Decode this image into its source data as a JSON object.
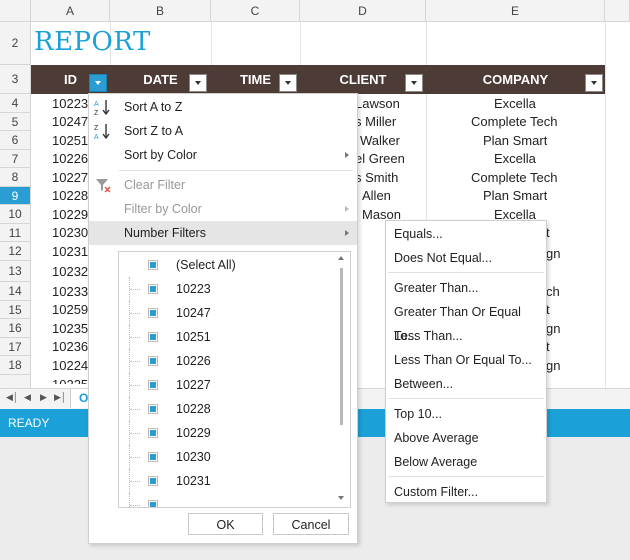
{
  "sheet": {
    "columns": [
      "A",
      "B",
      "C",
      "D",
      "E"
    ],
    "rows": [
      "2",
      "3",
      "4",
      "5",
      "6",
      "7",
      "8",
      "9",
      "10",
      "11",
      "12",
      "13",
      "14",
      "15",
      "16",
      "17",
      "18"
    ],
    "selected_row": "9",
    "report_title": "REPORT",
    "headers": [
      "ID",
      "DATE",
      "TIME",
      "CLIENT",
      "COMPANY"
    ],
    "ids": [
      "10223",
      "10247",
      "10251",
      "10226",
      "10227",
      "10228",
      "10229",
      "10230",
      "10231",
      "10232",
      "10233",
      "10259",
      "10235",
      "10236",
      "10224",
      "10225"
    ],
    "clients": [
      "Lawson",
      "s Miller",
      "Walker",
      "el Green",
      "s Smith",
      "Allen",
      "Mason"
    ],
    "companies": [
      "Excella",
      "Complete Tech",
      "Plan Smart",
      "Excella",
      "Complete Tech",
      "Plan Smart",
      "Excella"
    ],
    "company_fragments": [
      "t",
      "gn",
      "ch",
      "t",
      "gn",
      "t",
      "gn"
    ],
    "sheet_tab": "O",
    "status": "READY"
  },
  "filter_menu": {
    "sort_a_z": "Sort A to Z",
    "sort_z_a": "Sort Z to A",
    "sort_by_color": "Sort by Color",
    "clear_filter": "Clear Filter",
    "filter_by_color": "Filter by Color",
    "number_filters": "Number Filters",
    "values": [
      "(Select All)",
      "10223",
      "10247",
      "10251",
      "10226",
      "10227",
      "10228",
      "10229",
      "10230",
      "10231"
    ],
    "ok": "OK",
    "cancel": "Cancel"
  },
  "number_filters_submenu": {
    "items": [
      "Equals...",
      "Does Not Equal...",
      "Greater Than...",
      "Greater Than Or Equal To...",
      "Less Than...",
      "Less Than Or Equal To...",
      "Between...",
      "Top 10...",
      "Above Average",
      "Below Average",
      "Custom Filter..."
    ]
  },
  "colors": {
    "accent": "#1ba1d8",
    "header_bg": "#4d3b35",
    "selection": "#2a9ed3"
  }
}
